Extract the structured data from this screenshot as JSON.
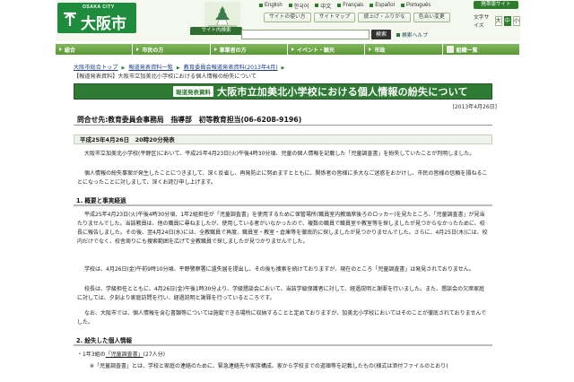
{
  "header": {
    "logo_small": "OSAKA CITY",
    "logo_name": "大阪市",
    "site_search_label": "サイト内検索",
    "languages": [
      "English",
      "한국어",
      "中文",
      "Français",
      "Español",
      "Português"
    ],
    "mobile_site": "携帯版サイト",
    "tools": [
      "サイトの使い方",
      "サイトマップ",
      "読上げ・ふりがな",
      "色合い変更"
    ],
    "font_size_label": "文字サイズ",
    "font_sizes": [
      "大",
      "中",
      "小"
    ],
    "search_button": "検索",
    "search_help": "検索ヘルプ"
  },
  "nav": {
    "items": [
      "総合",
      "市民の方",
      "事業者の方",
      "イベント・観光",
      "市政",
      "組織一覧"
    ]
  },
  "breadcrumb": {
    "items": [
      "大阪市総合トップ",
      "報道発表資料一覧",
      "教育委員会報道発表資料(2013年4月)"
    ],
    "current": "【報道発表資料】大阪市立加美北小学校における個人情報の紛失について"
  },
  "article": {
    "badge": "報道発表資料",
    "title": "大阪市立加美北小学校における個人情報の紛失について",
    "date": "[2013年4月26日]",
    "contact": "問合せ先:教育委員会事務局　指導部　初等教育担当(06-6208-9196)",
    "release": "平成25年4月26日　20時20分発表",
    "intro1": "大阪市立加美北小学校(平野区)において、平成25年4月23日(火)午後4時30分頃、児童の個人情報を記載した「児童調査書」を紛失していたことが判明しました。",
    "intro2": "個人情報の紛失事案が発生したことにつきまして、深く反省し、再発防止に努めますとともに、関係者の皆様に多大なご迷惑をおかけし、市民の皆様の信頼を損ねることになったことに対しまして、深くお詫び申し上げます。",
    "section1": "1. 概要と事実経過",
    "body1": "平成25年4月23日(火)午後4時30分頃、1年2組担任が「児童調査書」を使用するために保管場所(職員室内教頭席後ろのロッカー)を見たところ、「児童調査書」が見当たりませんでした。当該教員は、他の職員に尋ねましたが、使用している者がいなかったので、複数の職員で職員室や教室等を探しましたが見つからなかったために、校長に報告しました。その後、翌4月24日(水)には、全教職員で再度、職員室・教室・倉庫等を徹底的に探しましたが見つかりませんでした。さらに、4月25日(木)には、校内だけでなく、校舎周りにも捜索範囲を広げて全教職員で探しましたが見つかりませんでした。",
    "body2": "学校は、4月26日(金)午前9時10分頃、平野警察署に遺失届を提出し、その後も捜索を続けておりますが、現在のところ「児童調査書」は発見されておりません。",
    "body3": "校長は、学級担任とともに、4月26日(金)午後1時30分より、学級懇談会において、当該学級保護者に対して、経過説明と謝罪を行いました。また、懇談会の欠席家庭に対しては、夕刻より家庭訪問を行い、経過説明と謝罪を行っているところです。",
    "body4": "なお、大阪市では、個人情報を含む書類等については施錠できる場所に収納することと定めておりますが、加美北小学校においてはそのことが徹底されておりませんでした。",
    "section2": "2. 紛失した個人情報",
    "item1_prefix": "・1年3組の",
    "item1_link": "「児童調査書」",
    "item1_suffix": "(27人分)",
    "note": "※「児童調査書」とは、学校と家庭の連絡のために、緊急連絡先や家族構成、家から学校までの道順等を記載したもの(様式は添付ファイルのとおり)"
  }
}
